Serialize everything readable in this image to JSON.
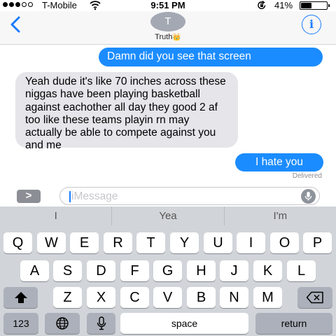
{
  "status_bar": {
    "carrier": "T-Mobile",
    "time": "9:51 PM",
    "battery_percent": "41%",
    "battery_level": 0.41,
    "signal_bars": 3
  },
  "header": {
    "avatar_initial": "T",
    "contact_name": "Truth",
    "contact_emoji": "👑",
    "info_label": "i"
  },
  "messages": [
    {
      "direction": "sent",
      "text": "Damn did you see that screen"
    },
    {
      "direction": "received",
      "text": "Yeah dude it's like 70 inches across these niggas have been playing basketball against eachother all day they good 2 af too like these teams playin rn may actually be able to compete against you and me"
    },
    {
      "direction": "sent",
      "text": "I hate you"
    }
  ],
  "delivery_status": "Delivered",
  "composer": {
    "apps_label": ">",
    "placeholder": "iMessage"
  },
  "keyboard": {
    "suggestions": [
      "I",
      "Yea",
      "I'm"
    ],
    "row1": [
      "Q",
      "W",
      "E",
      "R",
      "T",
      "Y",
      "U",
      "I",
      "O",
      "P"
    ],
    "row2": [
      "A",
      "S",
      "D",
      "F",
      "G",
      "H",
      "J",
      "K",
      "L"
    ],
    "row3": [
      "Z",
      "X",
      "C",
      "V",
      "B",
      "N",
      "M"
    ],
    "numbers_label": "123",
    "space_label": "space",
    "return_label": "return",
    "shift_icon": "shift-arrow-icon",
    "delete_icon": "backspace-icon",
    "globe_icon": "globe-icon",
    "mic_icon": "microphone-icon"
  },
  "colors": {
    "sent_bubble": "#1b8cff",
    "received_bubble": "#e5e5ea",
    "accent": "#1a7cff",
    "keyboard_bg": "#d1d4d9"
  }
}
